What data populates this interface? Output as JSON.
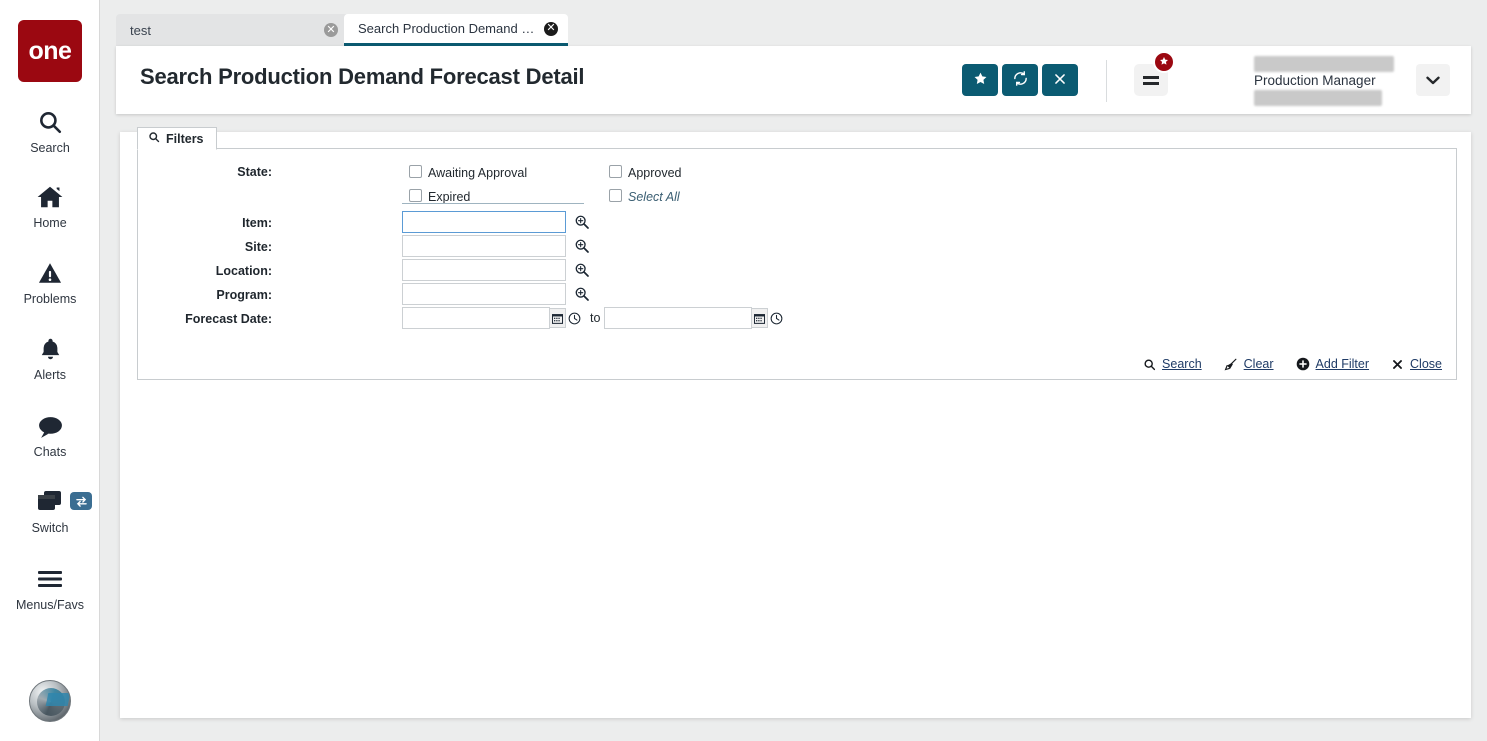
{
  "brand": {
    "logo_text": "one",
    "logo_color": "#9b0811"
  },
  "theme": {
    "accent": "#0b5b72",
    "link": "#1f3b66",
    "focus_border": "#5b9bd5",
    "page_bg": "#eceded"
  },
  "rail": {
    "items": [
      {
        "label": "Search",
        "icon": "search-icon"
      },
      {
        "label": "Home",
        "icon": "home-icon"
      },
      {
        "label": "Problems",
        "icon": "warning-triangle-icon"
      },
      {
        "label": "Alerts",
        "icon": "bell-icon"
      },
      {
        "label": "Chats",
        "icon": "chat-bubble-icon"
      },
      {
        "label": "Switch",
        "icon": "windows-stack-icon",
        "badge_icon": "swap-arrows-icon"
      },
      {
        "label": "Menus/Favs",
        "icon": "hamburger-icon"
      }
    ],
    "bottom_icon": "globe-avatar-icon"
  },
  "tabs": [
    {
      "label": "test",
      "active": false,
      "close_icon": "close-circle-icon"
    },
    {
      "label": "Search Production Demand Fore...",
      "active": true,
      "close_icon": "close-circle-icon"
    }
  ],
  "header": {
    "title": "Search Production Demand Forecast Detail",
    "buttons": [
      {
        "name": "favorite-button",
        "icon": "star-icon"
      },
      {
        "name": "reload-button",
        "icon": "refresh-icon"
      },
      {
        "name": "close-button",
        "icon": "x-icon"
      }
    ],
    "menu_icon": "hamburger-icon",
    "menu_badge_icon": "star-icon",
    "user_role": "Production Manager",
    "caret_icon": "chevron-down-icon"
  },
  "filters": {
    "tab_label": "Filters",
    "tab_icon": "search-icon",
    "state": {
      "label": "State:",
      "options": [
        {
          "label": "Awaiting Approval",
          "checked": false,
          "muted": false
        },
        {
          "label": "Approved",
          "checked": false,
          "muted": false
        },
        {
          "label": "Expired",
          "checked": false,
          "muted": false
        },
        {
          "label": "Select All",
          "checked": false,
          "muted": true
        }
      ]
    },
    "fields": [
      {
        "label": "Item:",
        "value": "",
        "placeholder": "",
        "focused": true,
        "lookup_icon": "magnifier-plus-icon"
      },
      {
        "label": "Site:",
        "value": "",
        "placeholder": "",
        "focused": false,
        "lookup_icon": "magnifier-plus-icon"
      },
      {
        "label": "Location:",
        "value": "",
        "placeholder": "",
        "focused": false,
        "lookup_icon": "magnifier-plus-icon"
      },
      {
        "label": "Program:",
        "value": "",
        "placeholder": "",
        "focused": false,
        "lookup_icon": "magnifier-plus-icon"
      }
    ],
    "date_range": {
      "label": "Forecast Date:",
      "from_value": "",
      "to_value": "",
      "separator": "to",
      "calendar_icon": "calendar-icon",
      "clock_icon": "clock-icon"
    },
    "actions": [
      {
        "label": "Search",
        "icon": "search-icon"
      },
      {
        "label": "Clear",
        "icon": "broom-icon"
      },
      {
        "label": "Add Filter",
        "icon": "plus-circle-icon"
      },
      {
        "label": "Close",
        "icon": "x-icon"
      }
    ]
  }
}
